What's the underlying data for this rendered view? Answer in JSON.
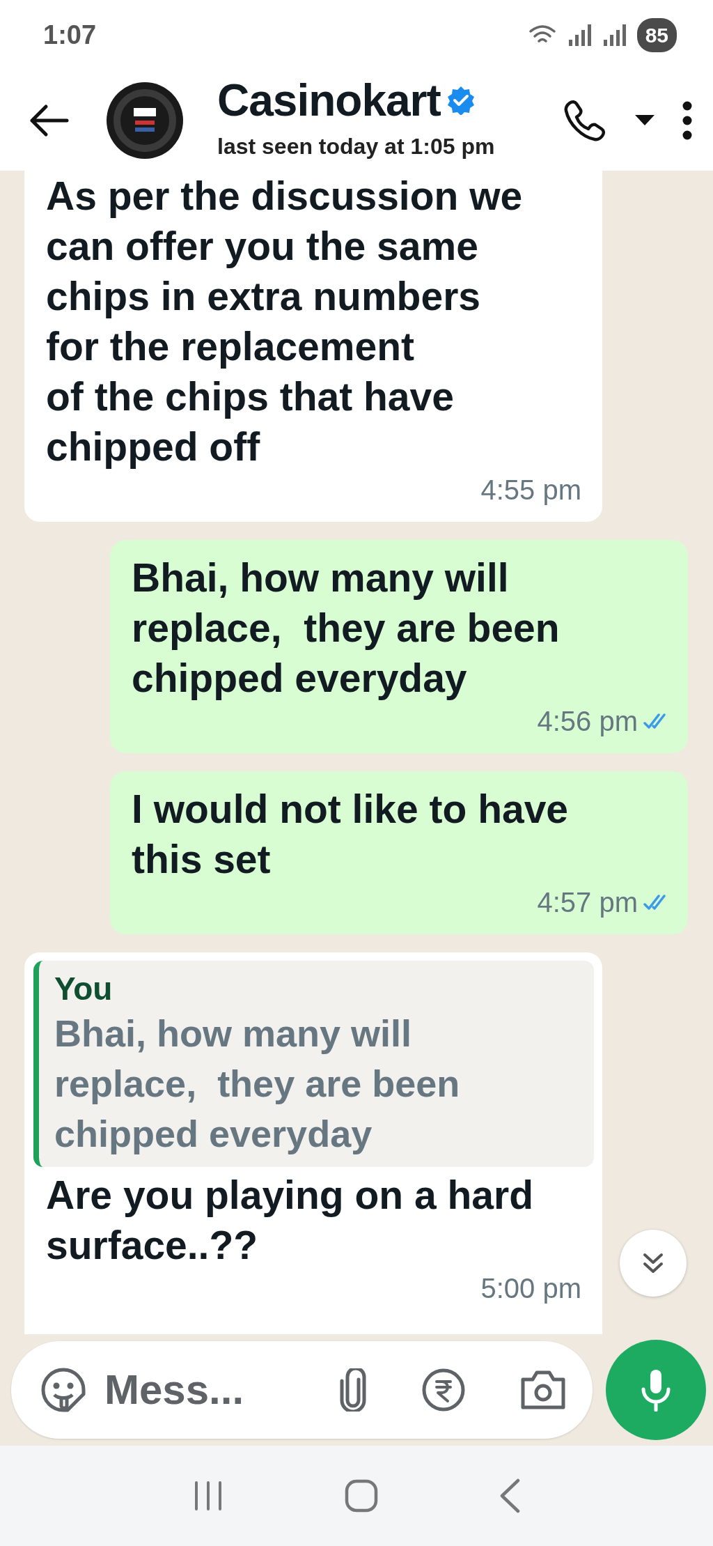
{
  "status_bar": {
    "time": "1:07",
    "battery": "85"
  },
  "header": {
    "title": "Casinokart",
    "verified": true,
    "subtitle": "last seen today at 1:05 pm"
  },
  "messages": [
    {
      "kind": "incoming",
      "text": "As per the discussion we\ncan offer you the same\nchips in extra numbers\nfor the replacement\nof the chips that have\nchipped off",
      "time": "4:55 pm"
    },
    {
      "kind": "outgoing",
      "text": "Bhai, how many will\nreplace,  they are been\nchipped everyday",
      "time": "4:56 pm",
      "read": true
    },
    {
      "kind": "outgoing",
      "text": "I would not like to have\nthis set",
      "time": "4:57 pm",
      "read": true
    },
    {
      "kind": "incoming",
      "quote": {
        "author": "You",
        "text": "Bhai, how many will\nreplace,  they are been\nchipped everyday"
      },
      "text": "Are you playing on a hard\nsurface..??",
      "time": "5:00 pm"
    }
  ],
  "composer": {
    "placeholder": "Mess..."
  }
}
